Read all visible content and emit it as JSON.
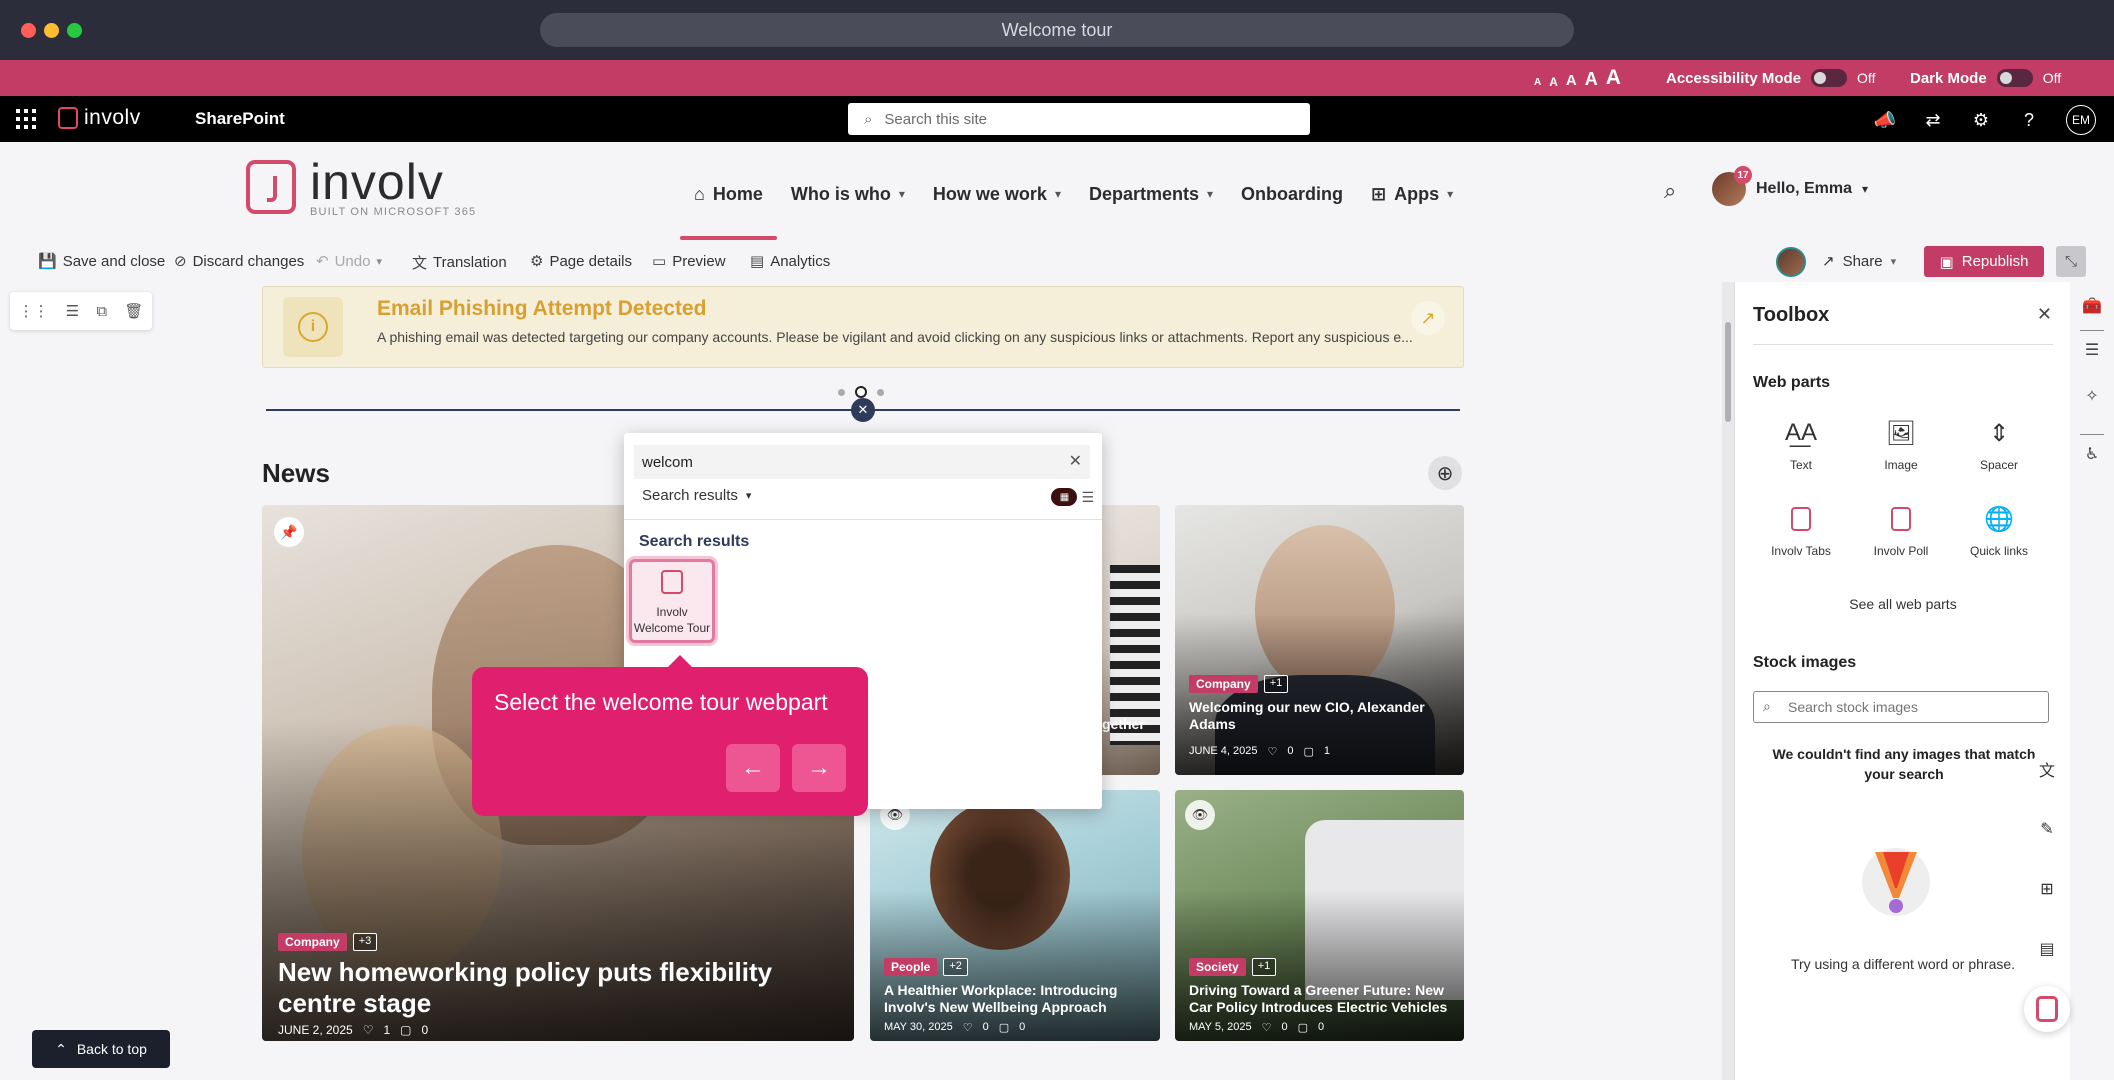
{
  "window": {
    "url_title": "Welcome tour"
  },
  "accessibility": {
    "size_glyphs": [
      "A",
      "A",
      "A",
      "A",
      "A"
    ],
    "accessibility_mode_label": "Accessibility Mode",
    "accessibility_mode_state": "Off",
    "dark_mode_label": "Dark Mode",
    "dark_mode_state": "Off",
    "bar_color": "#c23c66"
  },
  "suite": {
    "logo_text": "involv",
    "app_name": "SharePoint",
    "search_placeholder": "Search this site",
    "icons": [
      "megaphone-icon",
      "share-network-icon",
      "gear-icon",
      "help-icon"
    ],
    "user_initials": "EM"
  },
  "header": {
    "brand_word": "involv",
    "brand_sub": "BUILT ON MICROSOFT 365",
    "nav": [
      {
        "label": "Home",
        "icon": "home-icon",
        "active": true
      },
      {
        "label": "Who is who",
        "dropdown": true
      },
      {
        "label": "How we work",
        "dropdown": true
      },
      {
        "label": "Departments",
        "dropdown": true
      },
      {
        "label": "Onboarding"
      },
      {
        "label": "Apps",
        "icon": "apps-icon",
        "dropdown": true
      }
    ],
    "greeting": "Hello, Emma",
    "notification_count": "17"
  },
  "commandbar": {
    "save_close": "Save and close",
    "discard": "Discard changes",
    "undo": "Undo",
    "translation": "Translation",
    "page_details": "Page details",
    "preview": "Preview",
    "analytics": "Analytics",
    "share": "Share",
    "republish": "Republish"
  },
  "alert": {
    "title": "Email Phishing Attempt Detected",
    "text": "A phishing email was detected targeting our company accounts. Please be vigilant and avoid clicking on any suspicious links or attachments. Report any suspicious e..."
  },
  "news": {
    "title": "News",
    "cards": [
      {
        "tag": "Company",
        "more": "+3",
        "title": "New homeworking policy puts flexibility centre stage",
        "date": "JUNE 2, 2025",
        "likes": "1",
        "comments": "0"
      },
      {
        "tag": "Company",
        "more": "+1",
        "title": "Welcoming our new CIO, Alexander Adams",
        "date": "JUNE 4, 2025",
        "likes": "0",
        "comments": "1"
      },
      {
        "tag": "People",
        "more": "+2",
        "title": "A Healthier Workplace: Introducing Involv's New Wellbeing Approach",
        "date": "MAY 30, 2025",
        "likes": "0",
        "comments": "0"
      },
      {
        "tag": "Society",
        "more": "+1",
        "title": "Driving Toward a Greener Future: New Car Policy Introduces Electric Vehicles",
        "date": "MAY 5, 2025",
        "likes": "0",
        "comments": "0"
      }
    ],
    "partial_title_fragment": "gether"
  },
  "picker": {
    "search_value": "welcom",
    "filter_label": "Search results",
    "results_heading": "Search results",
    "result_label_line1": "Involv",
    "result_label_line2": "Welcome Tour"
  },
  "tour": {
    "text": "Select the welcome tour webpart",
    "prev_glyph": "←",
    "next_glyph": "→"
  },
  "back_to_top": "Back to top",
  "toolbox": {
    "title": "Toolbox",
    "web_parts_heading": "Web parts",
    "web_parts": [
      {
        "label": "Text",
        "icon": "text-icon"
      },
      {
        "label": "Image",
        "icon": "image-icon"
      },
      {
        "label": "Spacer",
        "icon": "spacer-icon"
      },
      {
        "label": "Involv Tabs",
        "icon": "involv-icon"
      },
      {
        "label": "Involv Poll",
        "icon": "involv-icon"
      },
      {
        "label": "Quick links",
        "icon": "globe-icon"
      }
    ],
    "see_all": "See all web parts",
    "stock_heading": "Stock images",
    "stock_placeholder": "Search stock images",
    "stock_empty": "We couldn't find any images that match your search",
    "stock_hint": "Try using a different word or phrase."
  }
}
